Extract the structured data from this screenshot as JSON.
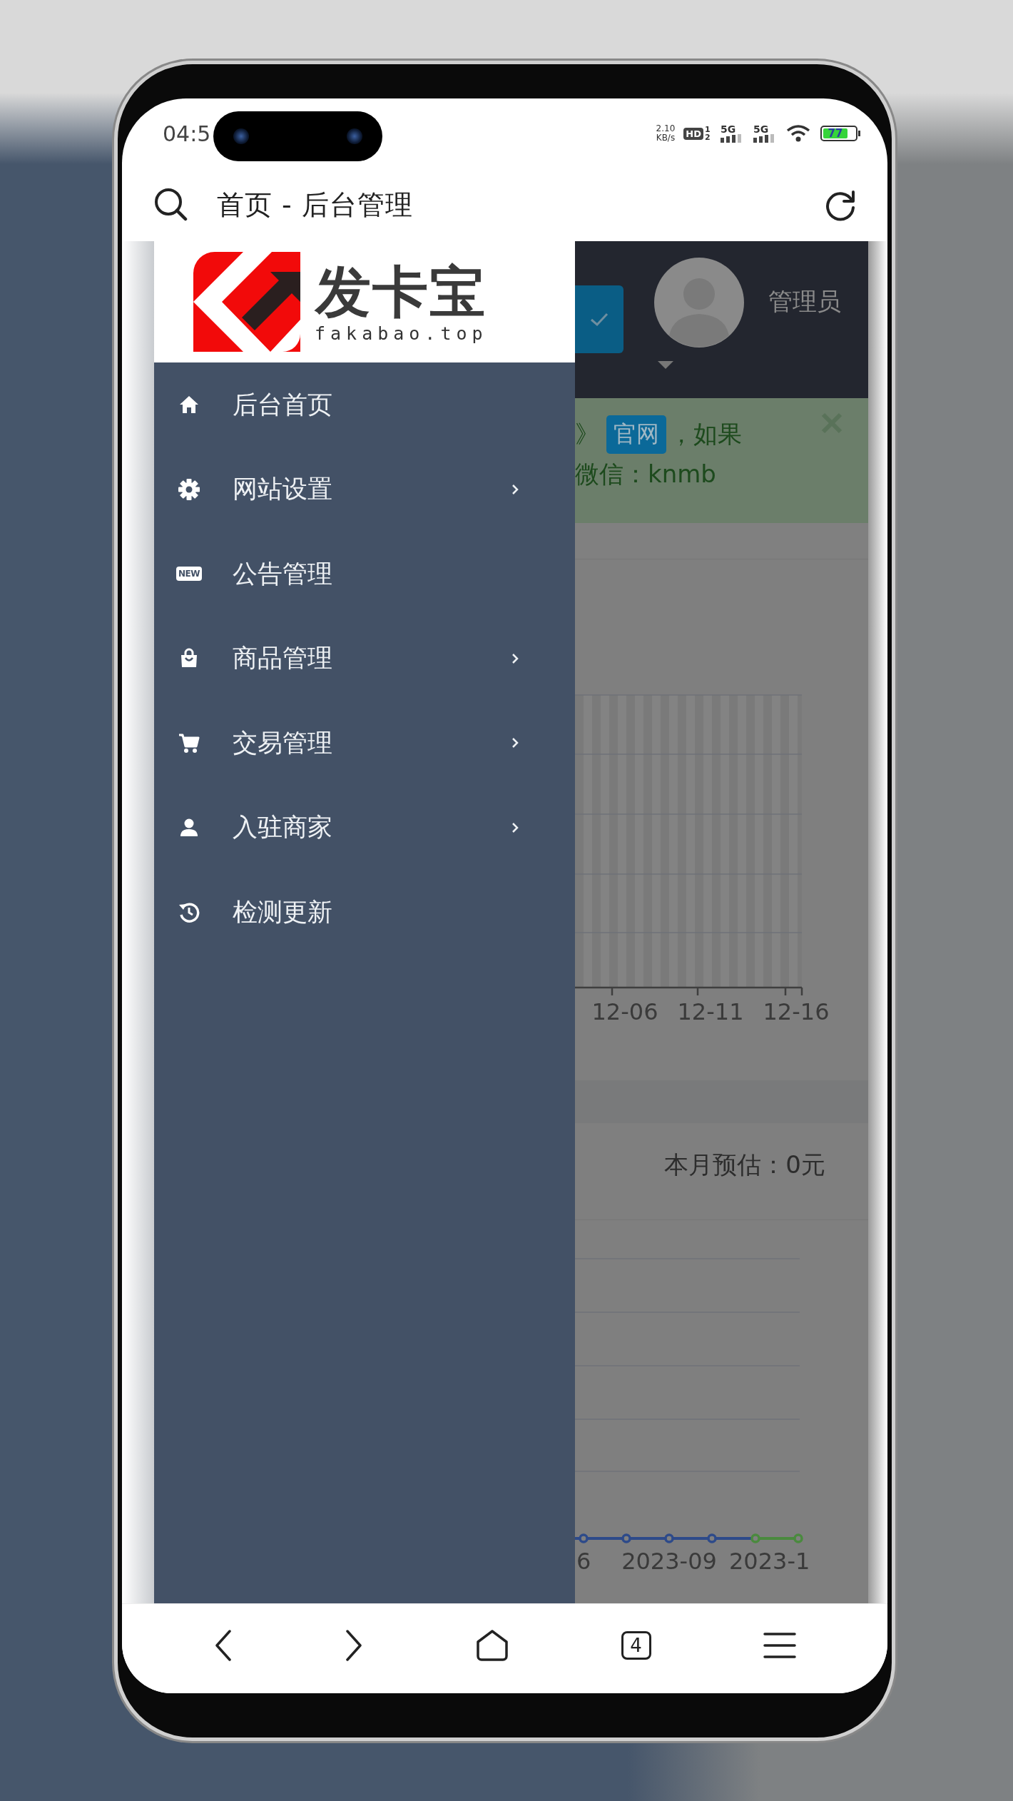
{
  "status_bar": {
    "time": "04:5",
    "net_speed": "2.10",
    "net_unit": "KB/s",
    "hd": "HD",
    "hd_sims": "1 2",
    "signals": [
      "5G",
      "5G"
    ],
    "battery": "77"
  },
  "browser_bar": {
    "title": "首页 - 后台管理"
  },
  "drawer": {
    "logo_name": "发卡宝",
    "logo_domain": "fakabao.top",
    "items": [
      {
        "kind": "home",
        "label": "后台首页",
        "expandable": false
      },
      {
        "kind": "gear",
        "label": "网站设置",
        "expandable": true
      },
      {
        "kind": "new",
        "icon_text": "NEW",
        "label": "公告管理",
        "expandable": false
      },
      {
        "kind": "bag",
        "label": "商品管理",
        "expandable": true
      },
      {
        "kind": "cart",
        "label": "交易管理",
        "expandable": true
      },
      {
        "kind": "person",
        "label": "入驻商家",
        "expandable": true
      },
      {
        "kind": "history",
        "label": "检测更新",
        "expandable": false
      }
    ]
  },
  "header": {
    "user": "管理员"
  },
  "notice": {
    "before": "》",
    "link": "官网",
    "after": "，如果",
    "line2": "微信：knmb"
  },
  "chart_1": {
    "x_labels": [
      "12-06",
      "12-11",
      "12-16"
    ]
  },
  "chart_2": {
    "title": "本月预估：0元",
    "x_labels": [
      "6",
      "2023-09",
      "2023-1"
    ]
  },
  "bottom_nav": {
    "tab_count": "4"
  }
}
